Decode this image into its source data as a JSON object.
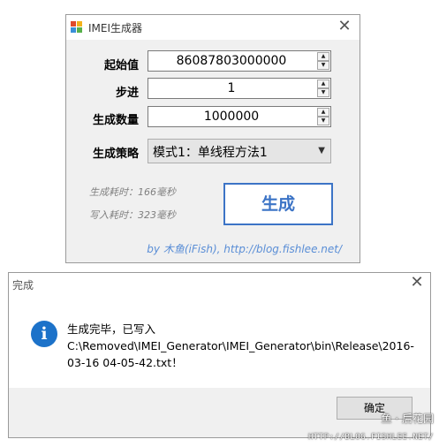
{
  "main_window": {
    "title": "IMEI生成器",
    "fields": {
      "start_label": "起始值",
      "start_value": "86087803000000",
      "step_label": "步进",
      "step_value": "1",
      "count_label": "生成数量",
      "count_value": "1000000",
      "strategy_label": "生成策略",
      "strategy_value": "模式1：单线程方法1"
    },
    "stats": {
      "gen_time": "生成耗时：166毫秒",
      "write_time": "写入耗时：323毫秒"
    },
    "generate_button": "生成",
    "credit": "by 木鱼(iFish), http://blog.fishlee.net/"
  },
  "dialog": {
    "title": "完成",
    "message_line1": "生成完毕，已写入",
    "message_line2": "C:\\Removed\\IMEI_Generator\\IMEI_Generator\\bin\\Release\\2016-",
    "message_line3": "03-16 04-05-42.txt！",
    "ok_button": "确定"
  },
  "watermark": {
    "text": "鱼 · 后花园",
    "url": "HTTP://BLOG.FISHLEE.NET/"
  },
  "icons": {
    "info": "info-icon",
    "close": "close-icon",
    "app": "app-icon",
    "spin_up": "spin-up-icon",
    "spin_down": "spin-down-icon",
    "dropdown": "chevron-down-icon"
  },
  "colors": {
    "accent_blue": "#3c74c6",
    "info_icon_blue": "#1c72c9",
    "stat_gray": "#808080",
    "credit_blue": "#5a8ed6"
  }
}
